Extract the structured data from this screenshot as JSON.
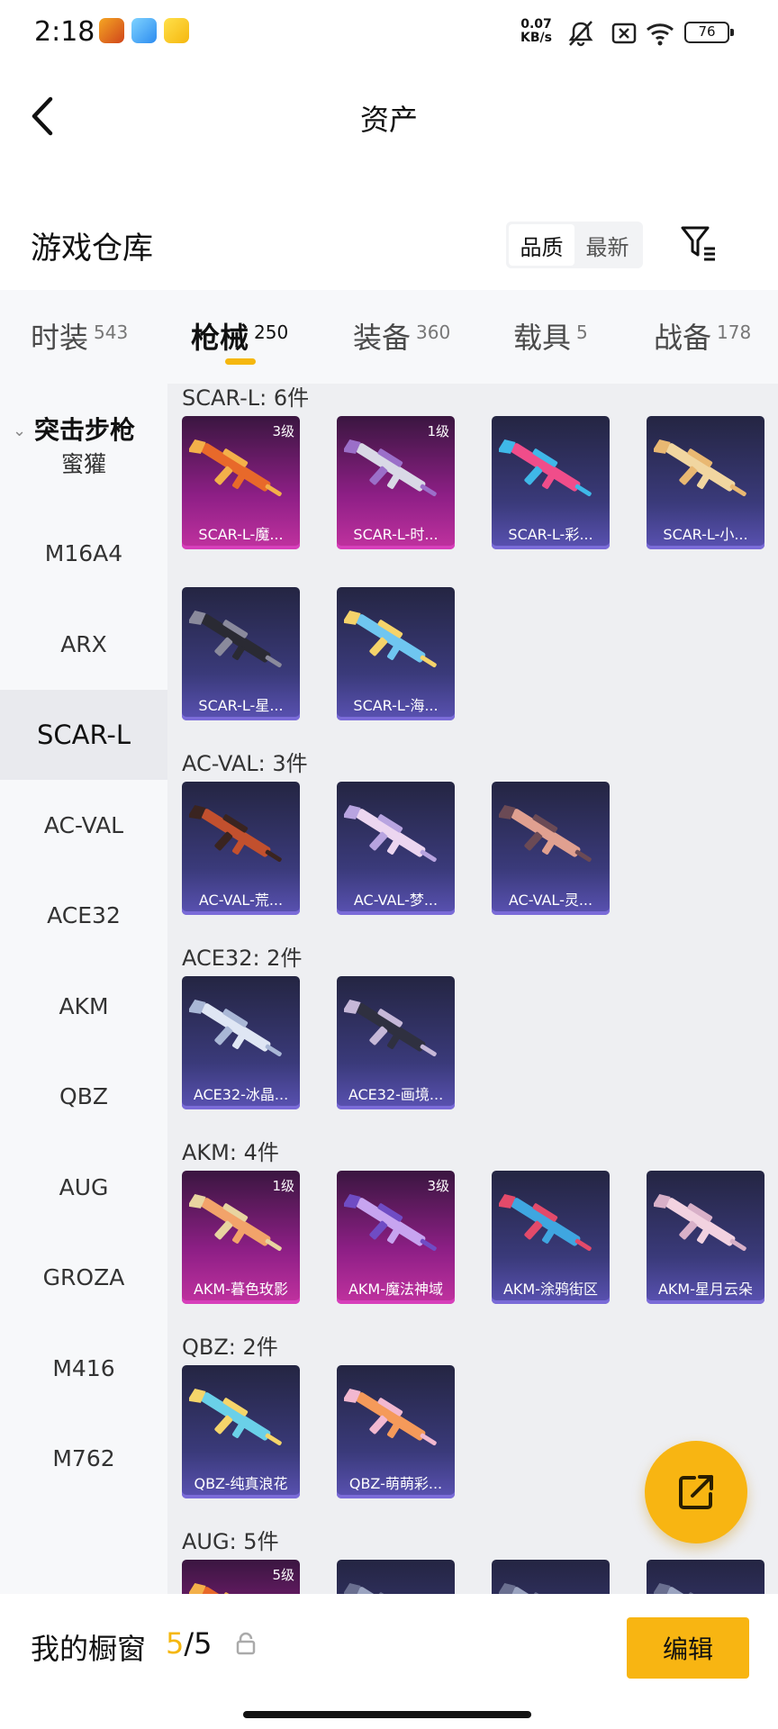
{
  "status_bar": {
    "time": "2:18",
    "net_speed_value": "0.07",
    "net_speed_unit": "KB/s",
    "battery": "76",
    "icons": [
      "game-app-icon",
      "blue-app-icon",
      "yellow-app-icon",
      "mute-icon",
      "sim-off-icon",
      "wifi-icon",
      "battery-icon"
    ]
  },
  "header": {
    "title": "资产",
    "back_icon": "chevron-left-icon"
  },
  "warehouse": {
    "title": "游戏仓库",
    "sort_options": [
      {
        "label": "品质",
        "active": true
      },
      {
        "label": "最新",
        "active": false
      }
    ],
    "filter_icon": "filter-icon"
  },
  "tabs": [
    {
      "label": "时装",
      "count": "543",
      "active": false
    },
    {
      "label": "枪械",
      "count": "250",
      "active": true
    },
    {
      "label": "装备",
      "count": "360",
      "active": false
    },
    {
      "label": "载具",
      "count": "5",
      "active": false
    },
    {
      "label": "战备",
      "count": "178",
      "active": false
    }
  ],
  "sidebar": {
    "group": "突击步枪",
    "items": [
      {
        "label": "蜜獾",
        "active": false
      },
      {
        "label": "M16A4",
        "active": false
      },
      {
        "label": "ARX",
        "active": false
      },
      {
        "label": "SCAR-L",
        "active": true
      },
      {
        "label": "AC-VAL",
        "active": false
      },
      {
        "label": "ACE32",
        "active": false
      },
      {
        "label": "AKM",
        "active": false
      },
      {
        "label": "QBZ",
        "active": false
      },
      {
        "label": "AUG",
        "active": false
      },
      {
        "label": "GROZA",
        "active": false
      },
      {
        "label": "M416",
        "active": false
      },
      {
        "label": "M762",
        "active": false
      }
    ]
  },
  "sections": [
    {
      "header": "SCAR-L: 6件",
      "items": [
        {
          "name": "SCAR-L-魔...",
          "level": "3级",
          "rarity": "purple",
          "colors": [
            "#e8692a",
            "#f3b04a"
          ]
        },
        {
          "name": "SCAR-L-时...",
          "level": "1级",
          "rarity": "purple",
          "colors": [
            "#d9d9e6",
            "#9b6fc9"
          ]
        },
        {
          "name": "SCAR-L-彩...",
          "level": "",
          "rarity": "blue",
          "colors": [
            "#f04d8a",
            "#3fb8e8"
          ]
        },
        {
          "name": "SCAR-L-小...",
          "level": "",
          "rarity": "blue",
          "colors": [
            "#f1d6a0",
            "#e9b872"
          ]
        },
        {
          "name": "SCAR-L-星...",
          "level": "",
          "rarity": "blue",
          "colors": [
            "#2a2a33",
            "#8a8a9c"
          ]
        },
        {
          "name": "SCAR-L-海...",
          "level": "",
          "rarity": "blue",
          "colors": [
            "#6fc6f0",
            "#f5d36a"
          ]
        }
      ]
    },
    {
      "header": "AC-VAL: 3件",
      "items": [
        {
          "name": "AC-VAL-荒...",
          "level": "",
          "rarity": "blue",
          "colors": [
            "#c2502e",
            "#3a2420"
          ]
        },
        {
          "name": "AC-VAL-梦...",
          "level": "",
          "rarity": "blue",
          "colors": [
            "#ecd6f0",
            "#b8a4e0"
          ]
        },
        {
          "name": "AC-VAL-灵...",
          "level": "",
          "rarity": "blue",
          "colors": [
            "#e0a090",
            "#6b4a55"
          ]
        }
      ]
    },
    {
      "header": "ACE32: 2件",
      "items": [
        {
          "name": "ACE32-冰晶...",
          "level": "",
          "rarity": "blue",
          "colors": [
            "#dfe6f4",
            "#a9b7d6"
          ]
        },
        {
          "name": "ACE32-画境...",
          "level": "",
          "rarity": "blue",
          "colors": [
            "#2f3040",
            "#c6b8d8"
          ]
        }
      ]
    },
    {
      "header": "AKM: 4件",
      "items": [
        {
          "name": "AKM-暮色玫影",
          "level": "1级",
          "rarity": "purple",
          "colors": [
            "#f2a36a",
            "#e8d4a0"
          ]
        },
        {
          "name": "AKM-魔法神域",
          "level": "3级",
          "rarity": "purple",
          "colors": [
            "#c7a4f0",
            "#6f4cc4"
          ]
        },
        {
          "name": "AKM-涂鸦街区",
          "level": "",
          "rarity": "blue",
          "colors": [
            "#3fa6e0",
            "#e34a6a"
          ]
        },
        {
          "name": "AKM-星月云朵",
          "level": "",
          "rarity": "blue",
          "colors": [
            "#f2d2e0",
            "#d8b0c8"
          ]
        }
      ]
    },
    {
      "header": "QBZ: 2件",
      "items": [
        {
          "name": "QBZ-纯真浪花",
          "level": "",
          "rarity": "blue",
          "colors": [
            "#6ad0e8",
            "#f5d56a"
          ]
        },
        {
          "name": "QBZ-萌萌彩...",
          "level": "",
          "rarity": "blue",
          "colors": [
            "#f59a5a",
            "#f2b8d0"
          ]
        }
      ]
    },
    {
      "header": "AUG: 5件",
      "items": [
        {
          "name": "",
          "level": "5级",
          "rarity": "purple",
          "colors": [
            "#e8692a",
            "#f3b04a"
          ]
        },
        {
          "name": "",
          "level": "",
          "rarity": "blue",
          "colors": [
            "#9ba4c0",
            "#6a6f90"
          ]
        },
        {
          "name": "",
          "level": "",
          "rarity": "blue",
          "colors": [
            "#9ba4c0",
            "#6a6f90"
          ]
        },
        {
          "name": "",
          "level": "",
          "rarity": "blue",
          "colors": [
            "#9ba4c0",
            "#6a6f90"
          ]
        }
      ]
    }
  ],
  "fab": {
    "icon": "share-external-icon"
  },
  "bottom_bar": {
    "label": "我的橱窗",
    "count_current": "5",
    "count_separator": "/5",
    "lock_icon": "lock-icon",
    "edit_label": "编辑"
  },
  "colors": {
    "accent": "#f8b512",
    "purple_card": "#c1329f",
    "blue_card": "#5a52b3"
  }
}
